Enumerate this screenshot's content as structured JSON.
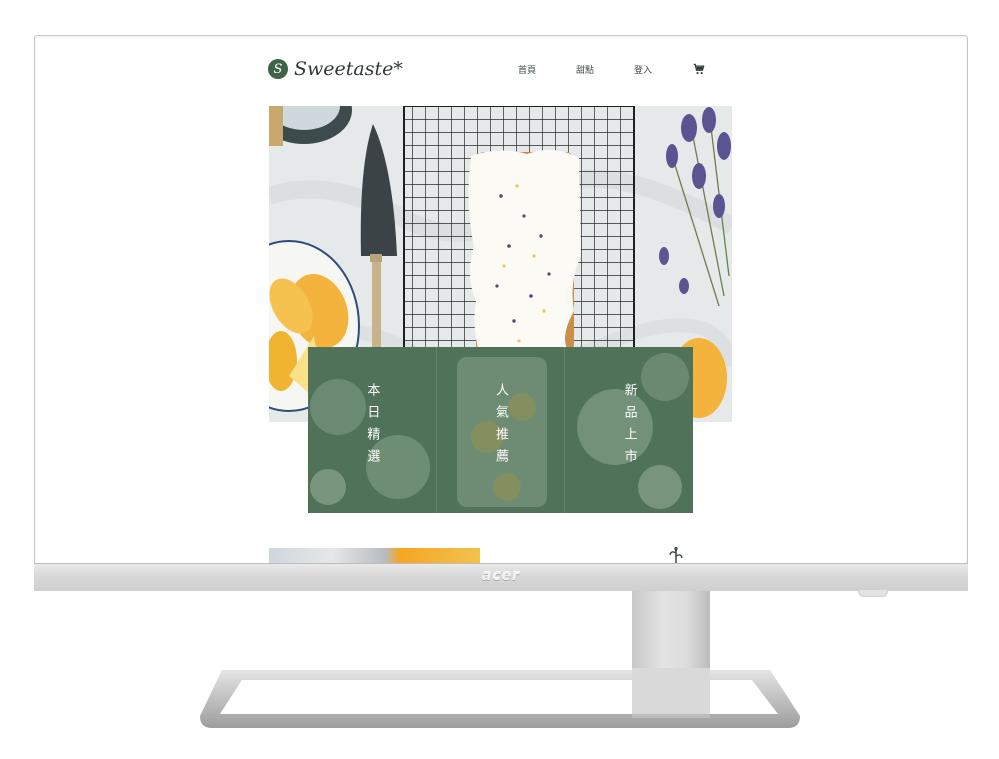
{
  "monitor": {
    "brand": "acer"
  },
  "site": {
    "logo": {
      "mark": "S",
      "text": "Sweetaste*"
    },
    "nav": [
      {
        "label": "首頁"
      },
      {
        "label": "甜點"
      },
      {
        "label": "登入"
      }
    ],
    "cart_icon": "shopping-cart-icon",
    "features": [
      {
        "label": "本日精選"
      },
      {
        "label": "人氣推薦"
      },
      {
        "label": "新品上市"
      }
    ],
    "colors": {
      "brand_green": "#4f7259",
      "text_dark": "#2e3b33"
    }
  }
}
